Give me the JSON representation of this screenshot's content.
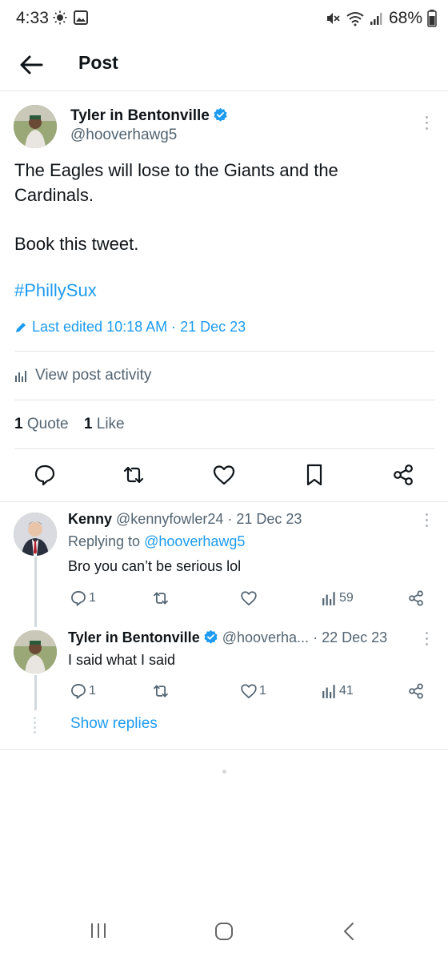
{
  "status_bar": {
    "time": "4:33",
    "battery": "68%"
  },
  "header": {
    "title": "Post"
  },
  "post": {
    "author_name": "Tyler in Bentonville",
    "author_handle": "@hooverhawg5",
    "text_line1": "The Eagles will lose to the Giants and the",
    "text_line2": "Cardinals.",
    "text_line3": "Book this tweet.",
    "hashtag": "#PhillySux",
    "edited": "Last edited 10:18 AM · 21 Dec 23",
    "activity_label": "View post activity",
    "quotes_count": "1",
    "quotes_label": "Quote",
    "likes_count": "1",
    "likes_label": "Like"
  },
  "replies": [
    {
      "name": "Kenny",
      "handle": "@kennyfowler24",
      "date": "· 21 Dec 23",
      "replying_prefix": "Replying to",
      "replying_to": "@hooverhawg5",
      "text": "Bro you can’t be serious lol",
      "reply_count": "1",
      "retweet_count": "",
      "like_count": "",
      "views": "59"
    },
    {
      "name": "Tyler in Bentonville",
      "handle": "@hooverha...",
      "date": "· 22 Dec 23",
      "text": "I said what I said",
      "reply_count": "1",
      "retweet_count": "",
      "like_count": "1",
      "views": "41"
    }
  ],
  "show_replies": "Show replies",
  "colors": {
    "accent": "#1d9bf0",
    "text": "#0f1419",
    "secondary": "#536471",
    "divider": "#e6e6e6"
  }
}
